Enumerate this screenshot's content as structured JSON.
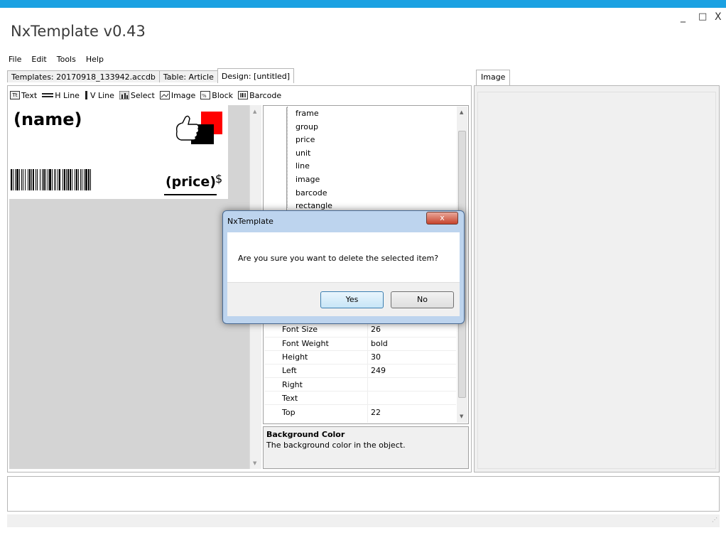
{
  "app_title": "NxTemplate v0.43",
  "window_controls": {
    "minimize": "_",
    "maximize": "□",
    "close": "X"
  },
  "menu": [
    "File",
    "Edit",
    "Tools",
    "Help"
  ],
  "tabs": [
    {
      "label": "Templates: 20170918_133942.accdb"
    },
    {
      "label": "Table: Article"
    },
    {
      "label": "Design: [untitled]"
    }
  ],
  "right_tab": "Image",
  "toolbar": [
    {
      "label": "Text",
      "icon": "text-icon"
    },
    {
      "label": "H Line",
      "icon": "h-line-icon"
    },
    {
      "label": "V Line",
      "icon": "v-line-icon"
    },
    {
      "label": "Select",
      "icon": "select-icon"
    },
    {
      "label": "Image",
      "icon": "image-icon"
    },
    {
      "label": "Block",
      "icon": "block-icon"
    },
    {
      "label": "Barcode",
      "icon": "barcode-icon"
    }
  ],
  "canvas": {
    "name_field": "(name)",
    "price_field": "(price)",
    "currency": "$",
    "red_square_color": "#ff0000"
  },
  "tree_items": [
    "frame",
    "group",
    "price",
    "unit",
    "line",
    "image",
    "barcode",
    "rectangle"
  ],
  "properties": [
    {
      "name": "Font Size",
      "value": "26"
    },
    {
      "name": "Font Weight",
      "value": "bold"
    },
    {
      "name": "Height",
      "value": "30"
    },
    {
      "name": "Left",
      "value": "249"
    },
    {
      "name": "Right",
      "value": ""
    },
    {
      "name": "Text",
      "value": ""
    },
    {
      "name": "Top",
      "value": "22"
    }
  ],
  "help": {
    "title": "Background Color",
    "description": "The background color in the object."
  },
  "dialog": {
    "title": "NxTemplate",
    "close": "x",
    "message": "Are you sure you want to delete the selected item?",
    "yes": "Yes",
    "no": "No"
  }
}
